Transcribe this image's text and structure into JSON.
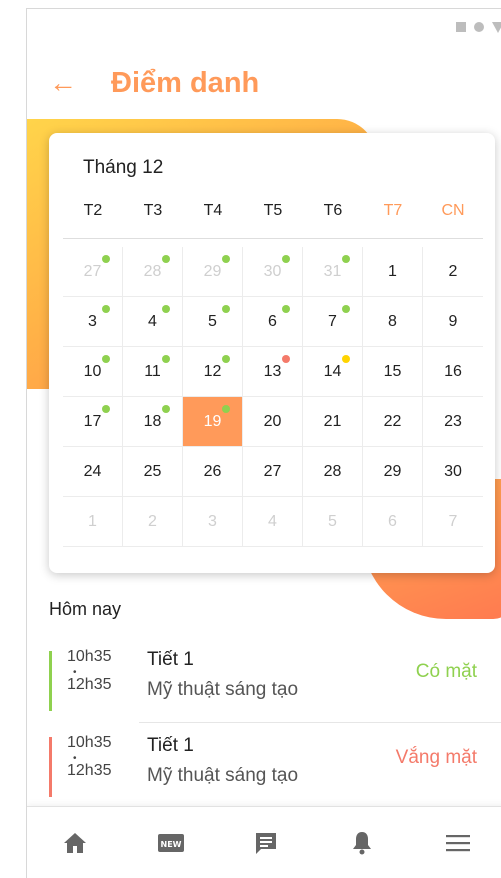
{
  "colors": {
    "accent": "#ff9a5a",
    "present": "#8fd14f",
    "absent": "#f47a6a",
    "pending": "#ffd400"
  },
  "header": {
    "title": "Điểm danh",
    "back_icon": "arrow-left-icon"
  },
  "calendar": {
    "month": "Tháng 12",
    "weekdays": [
      "T2",
      "T3",
      "T4",
      "T5",
      "T6",
      "T7",
      "CN"
    ],
    "weekend_indices": [
      5,
      6
    ],
    "days": [
      {
        "label": "27",
        "muted": true,
        "dot": "green"
      },
      {
        "label": "28",
        "muted": true,
        "dot": "green"
      },
      {
        "label": "29",
        "muted": true,
        "dot": "green"
      },
      {
        "label": "30",
        "muted": true,
        "dot": "green"
      },
      {
        "label": "31",
        "muted": true,
        "dot": "green"
      },
      {
        "label": "1"
      },
      {
        "label": "2"
      },
      {
        "label": "3",
        "dot": "green"
      },
      {
        "label": "4",
        "dot": "green"
      },
      {
        "label": "5",
        "dot": "green"
      },
      {
        "label": "6",
        "dot": "green"
      },
      {
        "label": "7",
        "dot": "green"
      },
      {
        "label": "8"
      },
      {
        "label": "9"
      },
      {
        "label": "10",
        "dot": "green"
      },
      {
        "label": "11",
        "dot": "green"
      },
      {
        "label": "12",
        "dot": "green"
      },
      {
        "label": "13",
        "dot": "red"
      },
      {
        "label": "14",
        "dot": "yellow"
      },
      {
        "label": "15"
      },
      {
        "label": "16"
      },
      {
        "label": "17",
        "dot": "green"
      },
      {
        "label": "18",
        "dot": "green"
      },
      {
        "label": "19",
        "dot": "green",
        "selected": true
      },
      {
        "label": "20"
      },
      {
        "label": "21"
      },
      {
        "label": "22"
      },
      {
        "label": "23"
      },
      {
        "label": "24"
      },
      {
        "label": "25"
      },
      {
        "label": "26"
      },
      {
        "label": "27"
      },
      {
        "label": "28"
      },
      {
        "label": "29"
      },
      {
        "label": "30"
      },
      {
        "label": "1",
        "muted": true
      },
      {
        "label": "2",
        "muted": true
      },
      {
        "label": "3",
        "muted": true
      },
      {
        "label": "4",
        "muted": true
      },
      {
        "label": "5",
        "muted": true
      },
      {
        "label": "6",
        "muted": true
      },
      {
        "label": "7",
        "muted": true
      }
    ]
  },
  "today": {
    "label": "Hôm nay",
    "sessions": [
      {
        "start": "10h35",
        "end": "12h35",
        "title": "Tiết 1",
        "subject": "Mỹ thuật sáng tạo",
        "status": "Có mặt",
        "status_color": "#8fd14f"
      },
      {
        "start": "10h35",
        "end": "12h35",
        "title": "Tiết 1",
        "subject": "Mỹ thuật sáng tạo",
        "status": "Vắng mặt",
        "status_color": "#f47a6a"
      }
    ]
  },
  "bottom_nav": {
    "items": [
      {
        "icon": "home-icon"
      },
      {
        "icon": "new-icon",
        "badge_text": "NEW"
      },
      {
        "icon": "message-icon"
      },
      {
        "icon": "bell-icon"
      },
      {
        "icon": "menu-icon"
      }
    ]
  }
}
